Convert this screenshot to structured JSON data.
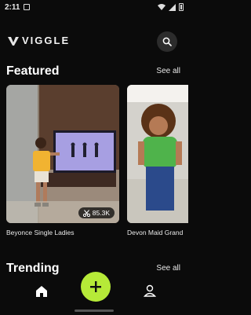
{
  "status": {
    "time": "2:11"
  },
  "app": {
    "name": "VIGGLE"
  },
  "featured": {
    "title": "Featured",
    "see_all": "See all"
  },
  "cards": [
    {
      "caption": "Beyonce Single Ladies",
      "count": "85.3K"
    },
    {
      "caption": "Devon Maid Grand"
    }
  ],
  "trending": {
    "title": "Trending",
    "see_all": "See all"
  },
  "colors": {
    "accent": "#b6ea38",
    "background": "#0b0b0b"
  }
}
